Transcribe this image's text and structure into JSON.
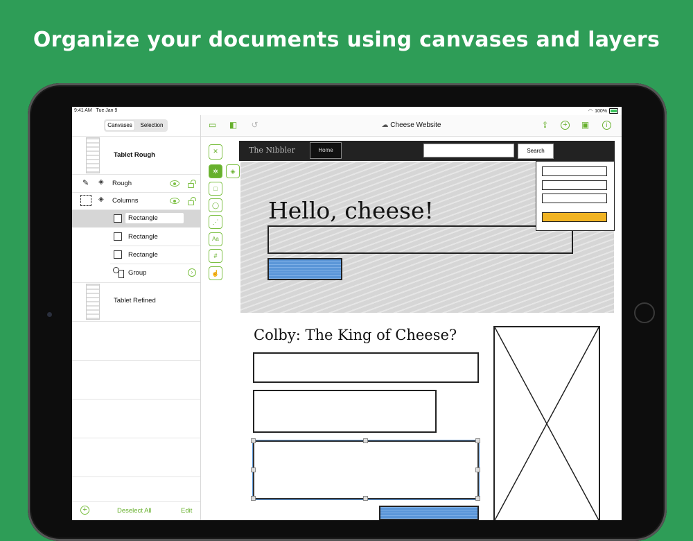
{
  "headline": "Organize your documents using canvases and layers",
  "status": {
    "time": "9:41 AM",
    "date": "Tue Jan 9",
    "battery": "100%"
  },
  "sidebar": {
    "segments": [
      {
        "label": "Canvases",
        "selected": true
      },
      {
        "label": "Selection",
        "selected": false
      }
    ],
    "canvases": [
      {
        "name": "Tablet Rough"
      },
      {
        "name": "Tablet Refined"
      }
    ],
    "layers": [
      {
        "label": "Rough",
        "icon": "pencil-icon"
      },
      {
        "label": "Columns",
        "icon": "selection-icon"
      }
    ],
    "items": [
      {
        "label": "Rectangle",
        "selected": true
      },
      {
        "label": "Rectangle",
        "selected": false
      },
      {
        "label": "Rectangle",
        "selected": false
      },
      {
        "label": "Group",
        "selected": false
      }
    ],
    "bottom": {
      "add_icon": "plus-icon",
      "deselect": "Deselect All",
      "edit": "Edit"
    }
  },
  "navbar": {
    "title": "Cheese Website"
  },
  "mockup": {
    "site_name": "The Nibbler",
    "nav_home": "Home",
    "search_button": "Search",
    "hero_title": "Hello, cheese!",
    "section_title": "Colby: The King of Cheese?"
  },
  "colors": {
    "accent": "#67b02d",
    "background": "#2e9d57",
    "blue": "#5b96d8",
    "yellow": "#f0b323"
  }
}
